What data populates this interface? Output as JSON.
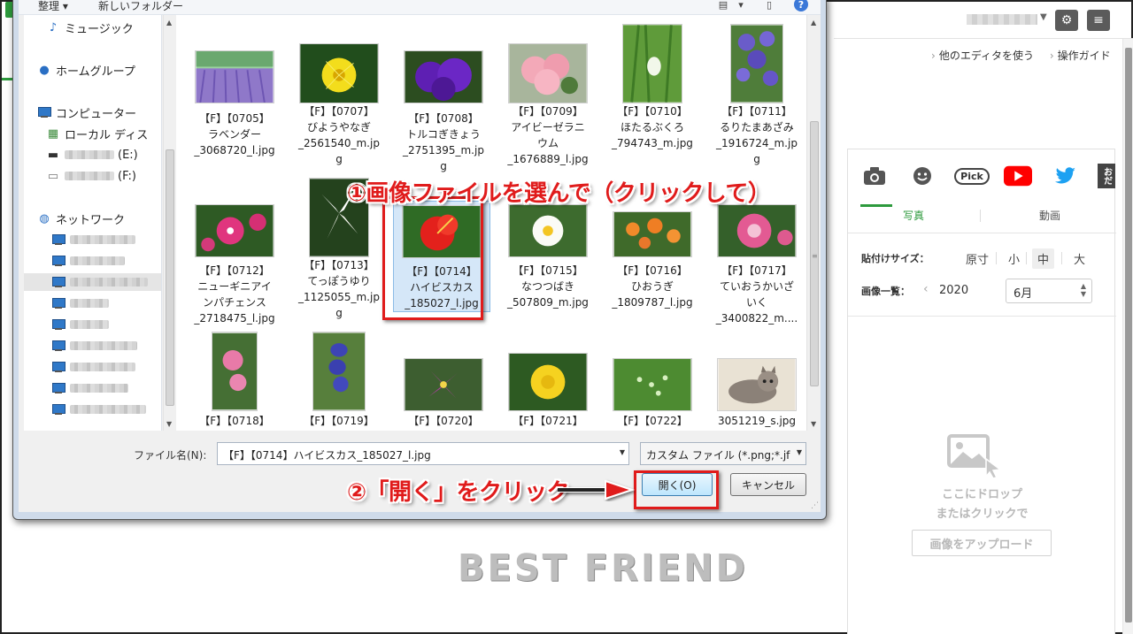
{
  "editor": {
    "links": [
      "他のエディタを使う",
      "操作ガイド"
    ],
    "tabs": {
      "photo": "写真",
      "video": "動画"
    },
    "paste_size": {
      "label": "貼付けサイズ：",
      "options": [
        "原寸",
        "小",
        "中",
        "大"
      ],
      "selected": "中"
    },
    "image_list": {
      "label": "画像一覧：",
      "year": "2020",
      "month": "6月",
      "prev": "‹"
    },
    "pick_label": "Pick",
    "side_label": "おだ",
    "dropzone": {
      "line1": "ここにドロップ",
      "line2": "またはクリックで",
      "upload_button": "画像をアップロード"
    },
    "accent_color": "#2d9a3d"
  },
  "watermark": "BEST FRIEND",
  "dialog": {
    "toolbar": {
      "organize": "整理 ▾",
      "new_folder": "新しいフォルダー"
    },
    "nav": {
      "music": "ミュージック",
      "homegroup": "ホームグループ",
      "computer": "コンピューター",
      "local_disk": "ローカル ディス",
      "drive_e": "(E:)",
      "drive_f": "(F:)",
      "network": "ネットワーク"
    },
    "files": [
      {
        "caption": "【F】【0705】\nラベンダー\n_3068720_l.jpg"
      },
      {
        "caption": "【F】【0707】\nびようやなぎ\n_2561540_m.jp\ng"
      },
      {
        "caption": "【F】【0708】\nトルコぎきょう\n_2751395_m.jp\ng"
      },
      {
        "caption": "【F】【0709】\nアイビーゼラニ\nウム\n_1676889_l.jpg"
      },
      {
        "caption": "【F】【0710】\nほたるぶくろ\n_794743_m.jpg"
      },
      {
        "caption": "【F】【0711】\nるりたまあざみ\n_1916724_m.jp\ng"
      },
      {
        "caption": "【F】【0712】\nニューギニアイ\nンパチェンス\n_2718475_l.jpg"
      },
      {
        "caption": "【F】【0713】\nてっぽうゆり\n_1125055_m.jp\ng"
      },
      {
        "caption": "【F】【0714】\nハイビスカス\n_185027_l.jpg"
      },
      {
        "caption": "【F】【0715】\nなつつばき\n_507809_m.jpg"
      },
      {
        "caption": "【F】【0716】\nひおうぎ\n_1809787_l.jpg"
      },
      {
        "caption": "【F】【0717】\nていおうかいざ\nいく\n_3400822_m...."
      },
      {
        "caption": "【F】【0718】"
      },
      {
        "caption": "【F】【0719】"
      },
      {
        "caption": "【F】【0720】"
      },
      {
        "caption": "【F】【0721】"
      },
      {
        "caption": "【F】【0722】"
      },
      {
        "caption": "3051219_s.jpg"
      }
    ],
    "filename_label": "ファイル名(N):",
    "filename_value": "【F】【0714】ハイビスカス_185027_l.jpg",
    "filetype_value": "カスタム ファイル (*.png;*.jf",
    "open_button": "開く(O)",
    "cancel_button": "キャンセル"
  },
  "annotations": {
    "step1": "①画像ファイルを選んで（クリックして）",
    "step2": "②「開く」をクリック",
    "highlight_color": "#e01b1b"
  }
}
